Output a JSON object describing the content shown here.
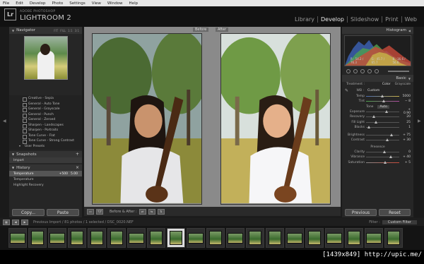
{
  "menu": [
    "File",
    "Edit",
    "Develop",
    "Photo",
    "Settings",
    "View",
    "Window",
    "Help"
  ],
  "app": {
    "logo": "Lr",
    "subtitle": "ADOBE PHOTOSHOP",
    "title": "LIGHTROOM 2"
  },
  "modules": [
    "Library",
    "Develop",
    "Slideshow",
    "Print",
    "Web"
  ],
  "left": {
    "navigator": {
      "title": "Navigator",
      "opts": [
        "FIT",
        "FILL",
        "1:1",
        "3:1"
      ]
    },
    "presets": [
      {
        "label": "Creative - Sepia",
        "folder": false
      },
      {
        "label": "General - Auto Tone",
        "folder": false
      },
      {
        "label": "General - Grayscale",
        "folder": false
      },
      {
        "label": "General - Punch",
        "folder": false
      },
      {
        "label": "General - Zeroed",
        "folder": false
      },
      {
        "label": "Sharpen - Landscapes",
        "folder": false
      },
      {
        "label": "Sharpen - Portraits",
        "folder": false
      },
      {
        "label": "Tone Curve - Flat",
        "folder": false
      },
      {
        "label": "Tone Curve - Strong Contrast",
        "folder": false
      },
      {
        "label": "User Presets",
        "folder": true
      }
    ],
    "snapshots": {
      "title": "Snapshots",
      "items": [
        "Import"
      ]
    },
    "history": {
      "title": "History",
      "items": [
        {
          "label": "Temperature",
          "v1": "+500",
          "v2": "5.00",
          "sel": true
        },
        {
          "label": "Temperature",
          "v1": "",
          "v2": "",
          "sel": false
        },
        {
          "label": "Highlight Recovery",
          "v1": "",
          "v2": "",
          "sel": false
        }
      ]
    },
    "copy": "Copy...",
    "paste": "Paste"
  },
  "center": {
    "before": "Before",
    "after": "After"
  },
  "toolbar": {
    "view": "Y|Y",
    "label": "Before & After :"
  },
  "right": {
    "histogram": {
      "title": "Histogram",
      "r": "R : 54.2 / 76.3",
      "g": "G : 45.7 / 65.7",
      "b": "B : 36.6 / 56.6"
    },
    "basic": {
      "title": "Basic",
      "treatment": "Treatment :",
      "color": "Color",
      "grayscale": "Grayscale",
      "wb": "WB :",
      "wb_value": "Custom",
      "temp": {
        "label": "Temp",
        "val": "5000",
        "pos": 0.45
      },
      "tint": {
        "label": "Tint",
        "val": "− 8",
        "pos": 0.48
      },
      "tone": "Tone",
      "auto": "Auto",
      "tones": [
        {
          "label": "Exposure",
          "val": "+ 0.90",
          "pos": 0.58
        },
        {
          "label": "Recovery",
          "val": "20",
          "pos": 0.2
        },
        {
          "label": "Fill Light",
          "val": "25",
          "pos": 0.25
        },
        {
          "label": "Blacks",
          "val": "1",
          "pos": 0.05
        },
        {
          "label": "Brightness",
          "val": "+ 75",
          "pos": 0.72
        },
        {
          "label": "Contrast",
          "val": "+ 30",
          "pos": 0.6
        }
      ],
      "presence": "Presence",
      "pres": [
        {
          "label": "Clarity",
          "val": "0",
          "pos": 0.5
        },
        {
          "label": "Vibrance",
          "val": "+ 40",
          "pos": 0.7
        },
        {
          "label": "Saturation",
          "val": "+ 5",
          "pos": 0.53
        }
      ]
    },
    "previous": "Previous",
    "reset": "Reset"
  },
  "filmstrip": {
    "info": "Previous Import / 81 photos / 1 selected / DSC_0020.NEF",
    "filter": "Filter :",
    "filter_val": "Custom Filter"
  },
  "caption": "[1439x849] http://upic.me/"
}
